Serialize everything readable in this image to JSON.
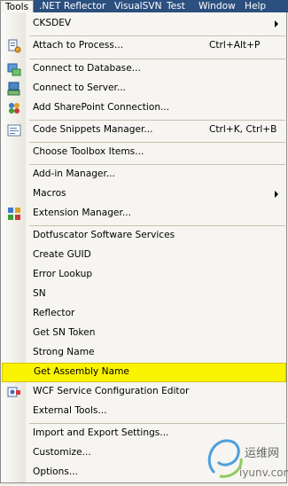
{
  "menubar": [
    "Tools",
    ".NET Reflector",
    "VisualSVN",
    "Test",
    "Window",
    "Help"
  ],
  "menu_items": {
    "cksdev": "CKSDEV",
    "attach": "Attach to Process...",
    "attach_sc": "Ctrl+Alt+P",
    "connect_db": "Connect to Database...",
    "connect_server": "Connect to Server...",
    "add_sharepoint": "Add SharePoint Connection...",
    "code_snippets": "Code Snippets Manager...",
    "code_snippets_sc": "Ctrl+K, Ctrl+B",
    "toolbox": "Choose Toolbox Items...",
    "addin": "Add-in Manager...",
    "macros": "Macros",
    "extension": "Extension Manager...",
    "dotfuscator": "Dotfuscator Software Services",
    "guid": "Create GUID",
    "error_lookup": "Error Lookup",
    "sn": "SN",
    "reflector": "Reflector",
    "sn_token": "Get SN Token",
    "strong_name": "Strong Name",
    "assembly": "Get Assembly Name",
    "wcf": "WCF Service Configuration Editor",
    "external": "External Tools...",
    "import_export": "Import and Export Settings...",
    "customize": "Customize...",
    "options": "Options..."
  },
  "watermark": {
    "cn": "运维网",
    "url": "iyunv.com"
  },
  "colors": {
    "menubar_bg": "#2b4f7e",
    "highlight": "#fbf400",
    "menu_bg": "#f6f5f1"
  },
  "icons": [
    "attach-process-icon",
    "database-icon",
    "server-icon",
    "sharepoint-icon",
    "snippets-icon",
    "extension-manager-icon",
    "wcf-icon"
  ]
}
